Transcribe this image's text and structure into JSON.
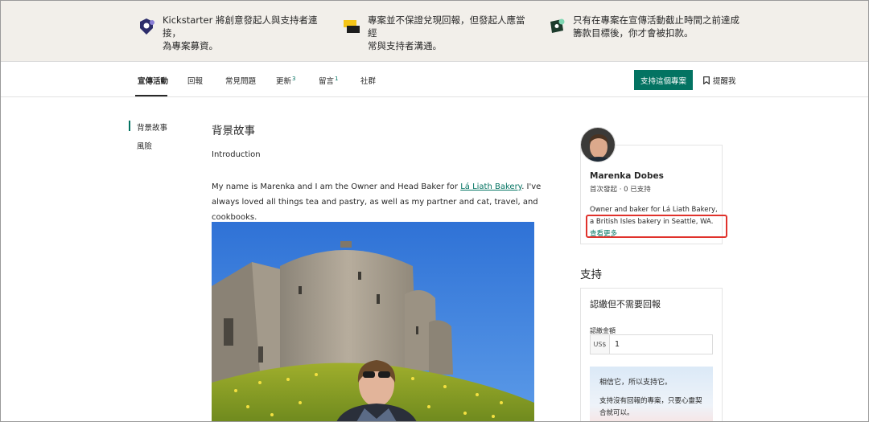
{
  "banner": {
    "items": [
      {
        "text_1": "Kickstarter 將創意發起人與支持者連接，",
        "text_2": "為專案募資。",
        "icon": "kickstarter-badge-icon"
      },
      {
        "text_1": "專案並不保證兌現回報，但發起人應當經",
        "text_2": "常與支持者溝通。",
        "icon": "chat-bubbles-icon"
      },
      {
        "text_1": "只有在專案在宣傳活動截止時間之前達成",
        "text_2": "籌款目標後，你才會被扣款。",
        "icon": "money-check-icon"
      }
    ]
  },
  "nav": {
    "tabs": [
      {
        "label": "宣傳活動",
        "badge": ""
      },
      {
        "label": "回報",
        "badge": ""
      },
      {
        "label": "常見問題",
        "badge": ""
      },
      {
        "label": "更新",
        "badge": "3"
      },
      {
        "label": "留言",
        "badge": "1"
      },
      {
        "label": "社群",
        "badge": ""
      }
    ],
    "back_button": "支持這個專案",
    "remind": "提醒我"
  },
  "sidebar": {
    "items": [
      "背景故事",
      "風險"
    ]
  },
  "story": {
    "title": "背景故事",
    "intro_heading": "Introduction",
    "para_before": "My name is Marenka and I am the Owner and Head Baker for ",
    "para_link": "Lá Liath Bakery",
    "para_after": ". I've always loved all things tea and pastry, as well as my partner and cat, travel, and cookbooks."
  },
  "creator": {
    "name": "Marenka Dobes",
    "meta": "首次發起 · 0 已支持",
    "bio": "Owner and baker for Lá Liath Bakery, a British Isles bakery in Seattle, WA.",
    "see_more": "查看更多"
  },
  "support": {
    "title": "支持",
    "pledge_title": "認繳但不需要回報",
    "amount_label": "認繳金額",
    "currency": "US$",
    "amount_value": "1",
    "box_title": "相信它，所以支持它。",
    "box_desc": "支持沒有回報的專案，只要心靈契合就可以。"
  },
  "colors": {
    "accent": "#037362",
    "banner_bg": "#f2efea",
    "highlight": "#e0322c"
  }
}
